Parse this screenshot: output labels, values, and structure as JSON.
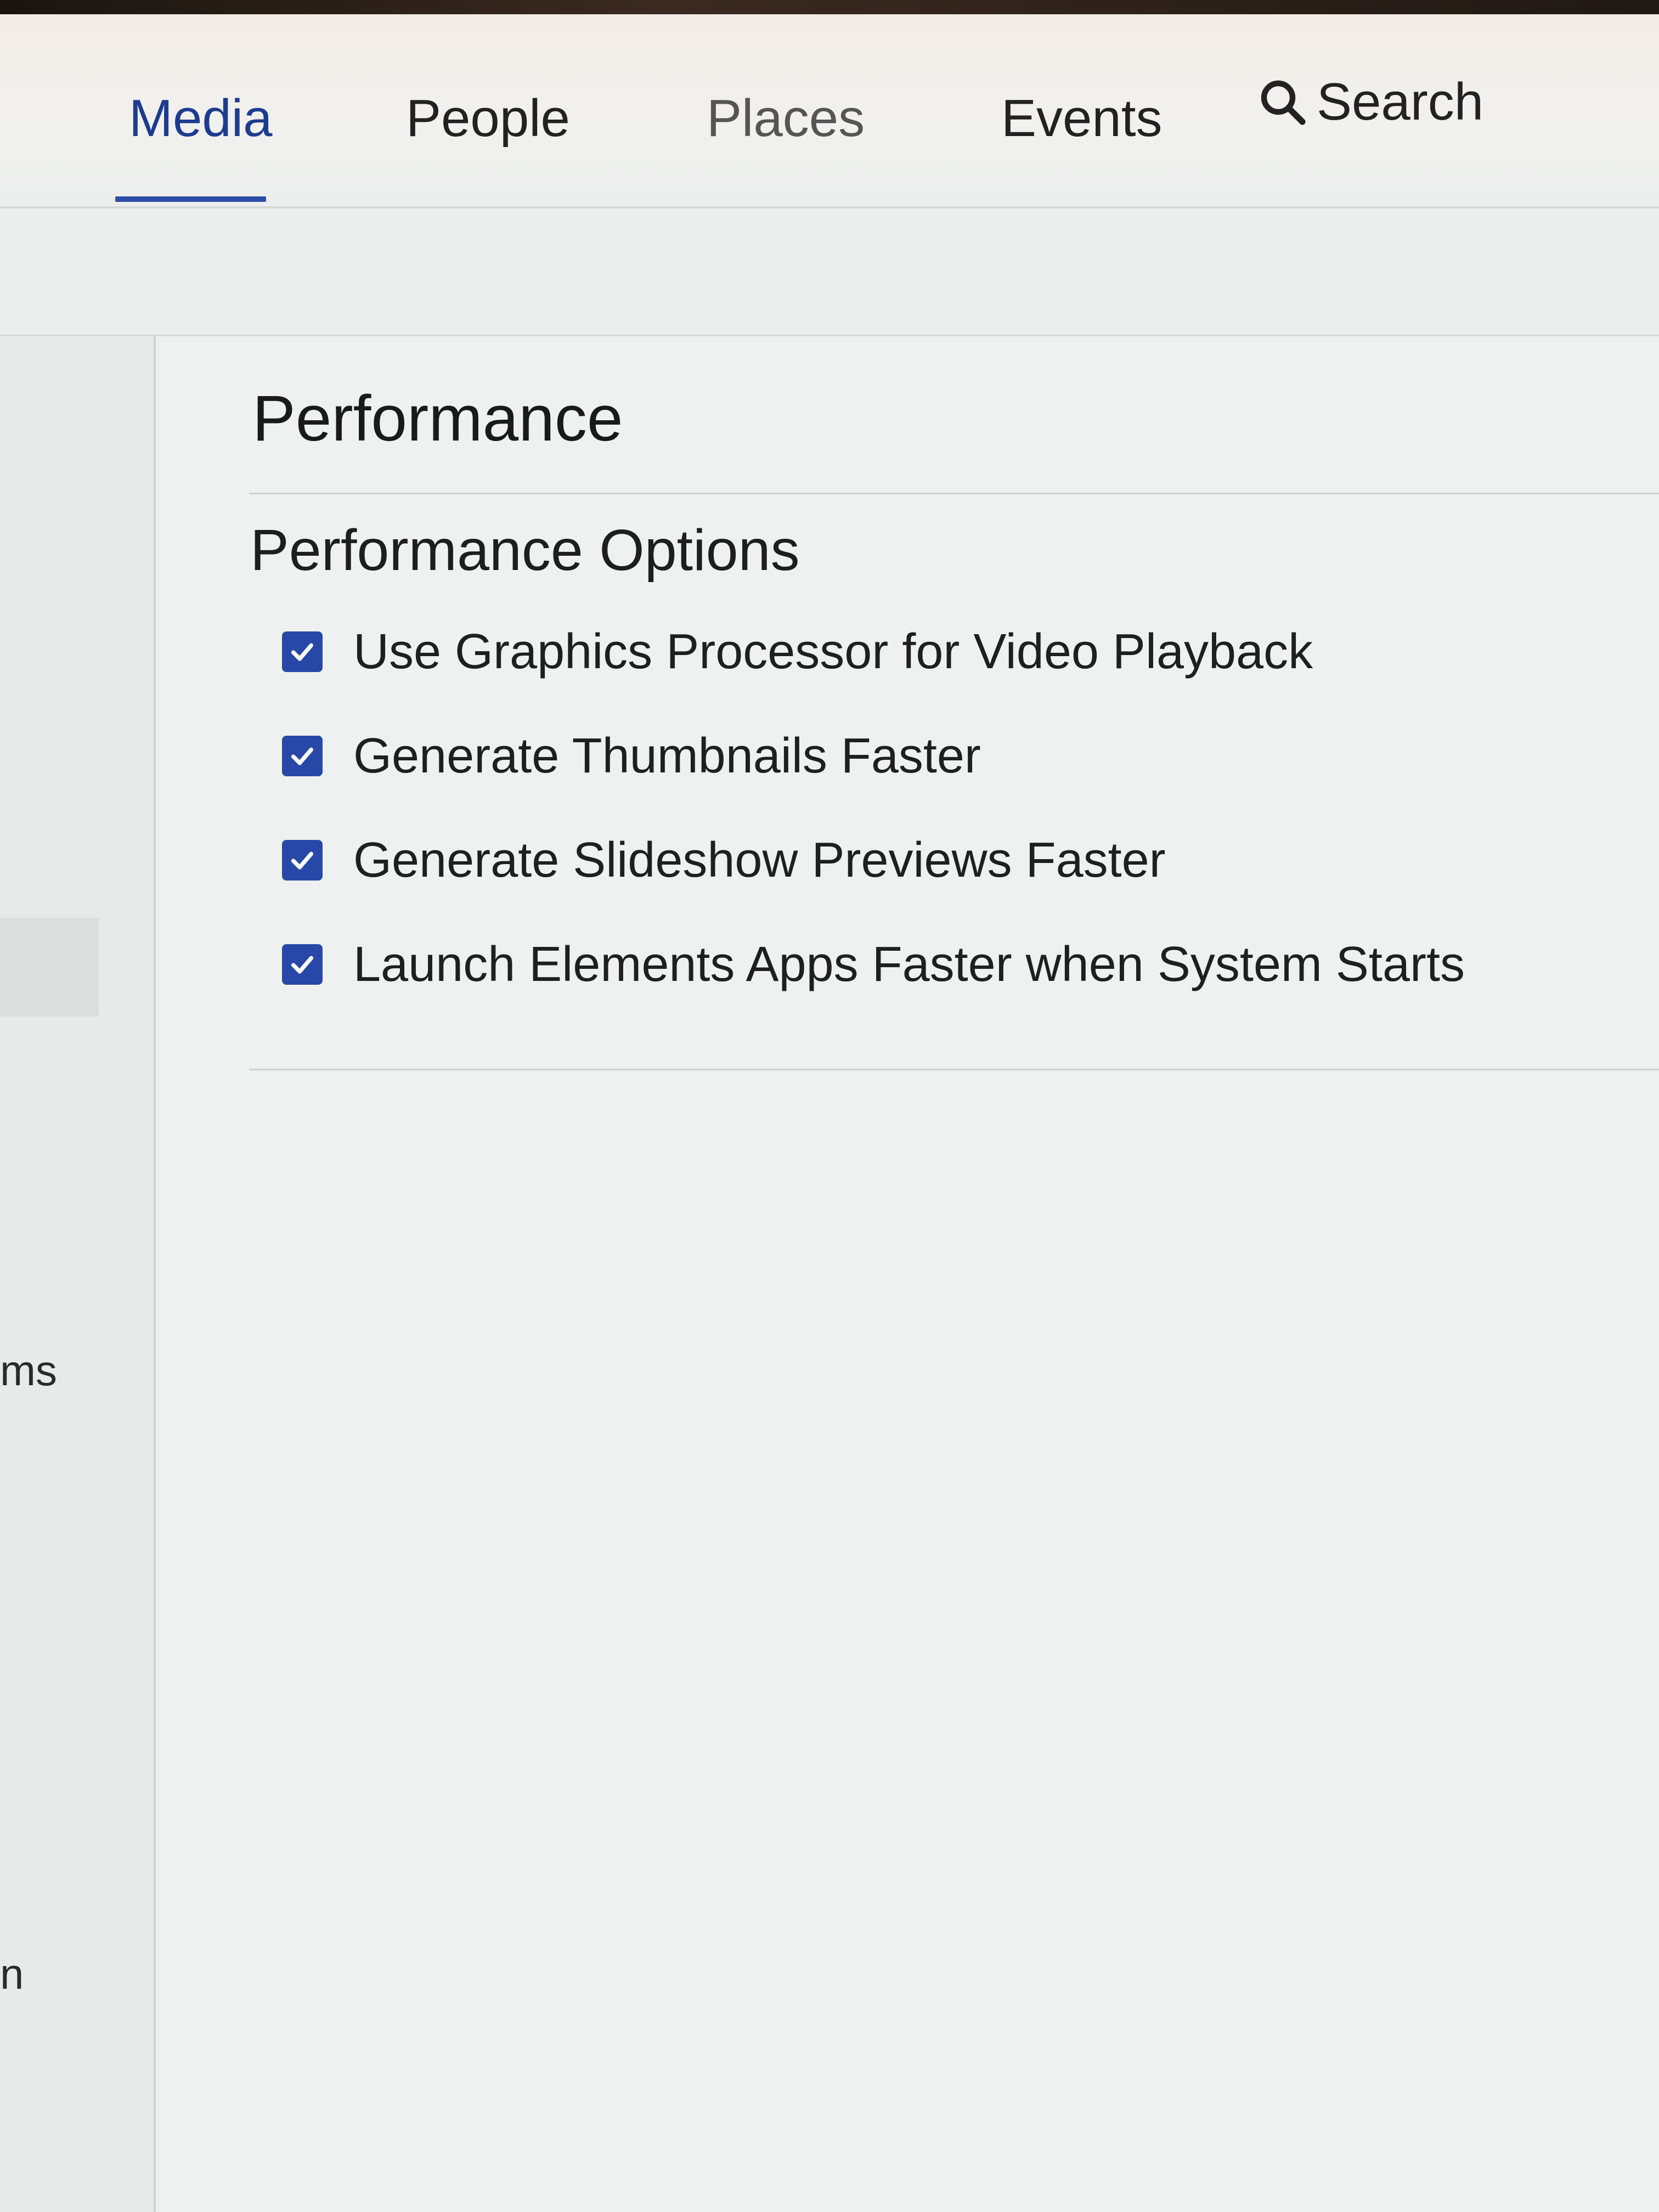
{
  "nav": {
    "tabs": [
      {
        "label": "Media",
        "active": true
      },
      {
        "label": "People",
        "active": false
      },
      {
        "label": "Places",
        "active": false
      },
      {
        "label": "Events",
        "active": false
      }
    ],
    "search_label": "Search",
    "accent_color": "#2d4ea6"
  },
  "sidebar": {
    "partial_text_1": "ms",
    "partial_text_2": "n"
  },
  "main": {
    "title": "Performance",
    "section_title": "Performance Options",
    "options": [
      {
        "label": "Use Graphics Processor for Video Playback",
        "checked": true
      },
      {
        "label": "Generate Thumbnails Faster",
        "checked": true
      },
      {
        "label": "Generate Slideshow Previews Faster",
        "checked": true
      },
      {
        "label": "Launch Elements Apps Faster when System Starts",
        "checked": true
      }
    ],
    "checkbox_color": "#2848a8"
  },
  "icons": {
    "search": "search-icon",
    "checkmark": "checkmark-icon"
  }
}
